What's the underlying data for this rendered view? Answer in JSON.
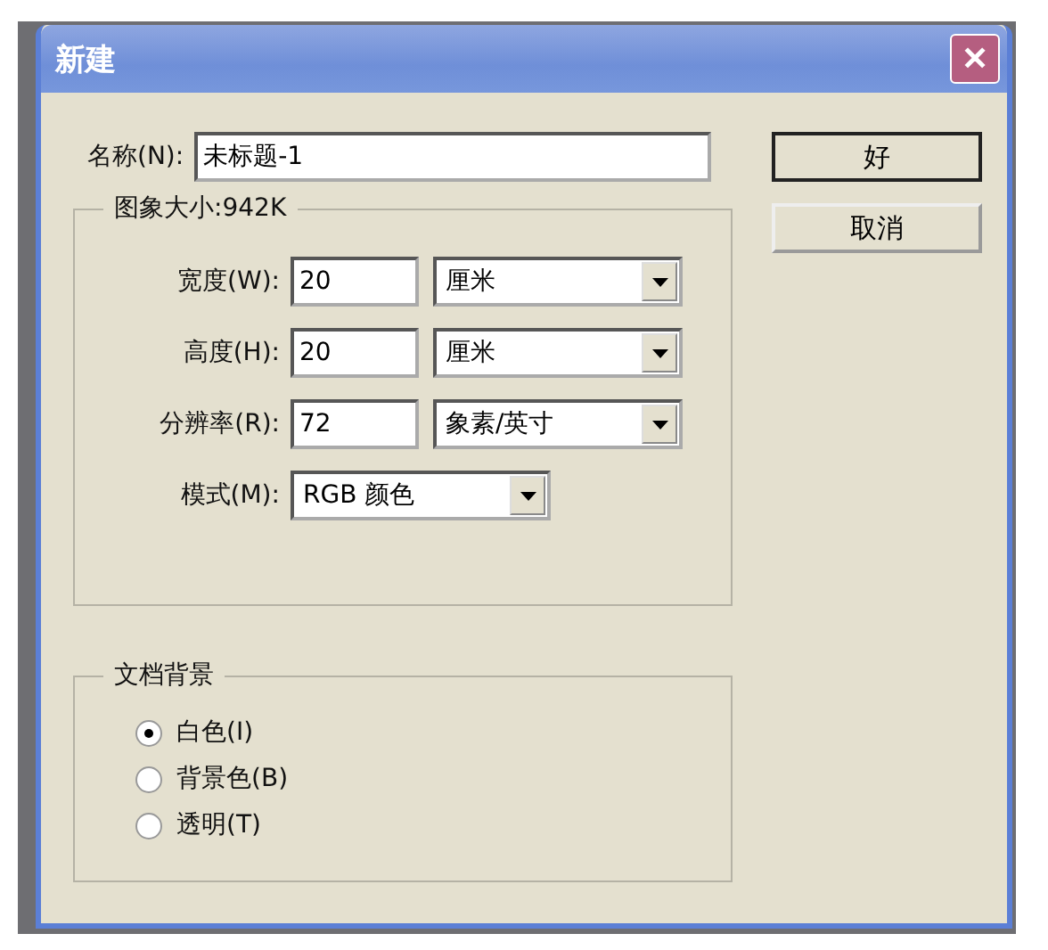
{
  "window": {
    "title": "新建",
    "close": "✕"
  },
  "name_field": {
    "label": "名称(N):",
    "value": "未标题-1"
  },
  "buttons": [
    {
      "label": "好",
      "default": true
    },
    {
      "label": "取消",
      "default": false
    }
  ],
  "image_size": {
    "title": "图象大小:942K",
    "rows": [
      {
        "kind": "number",
        "label": "宽度(W):",
        "value": "20",
        "unit": "厘米"
      },
      {
        "kind": "number",
        "label": "高度(H):",
        "value": "20",
        "unit": "厘米"
      },
      {
        "kind": "number",
        "label": "分辨率(R):",
        "value": "72",
        "unit": "象素/英寸"
      },
      {
        "kind": "select",
        "label": "模式(M):",
        "unit": "RGB 颜色"
      }
    ]
  },
  "background": {
    "title": "文档背景",
    "options": [
      {
        "label": "白色(I)",
        "selected": true
      },
      {
        "label": "背景色(B)",
        "selected": false
      },
      {
        "label": "透明(T)",
        "selected": false
      }
    ]
  }
}
